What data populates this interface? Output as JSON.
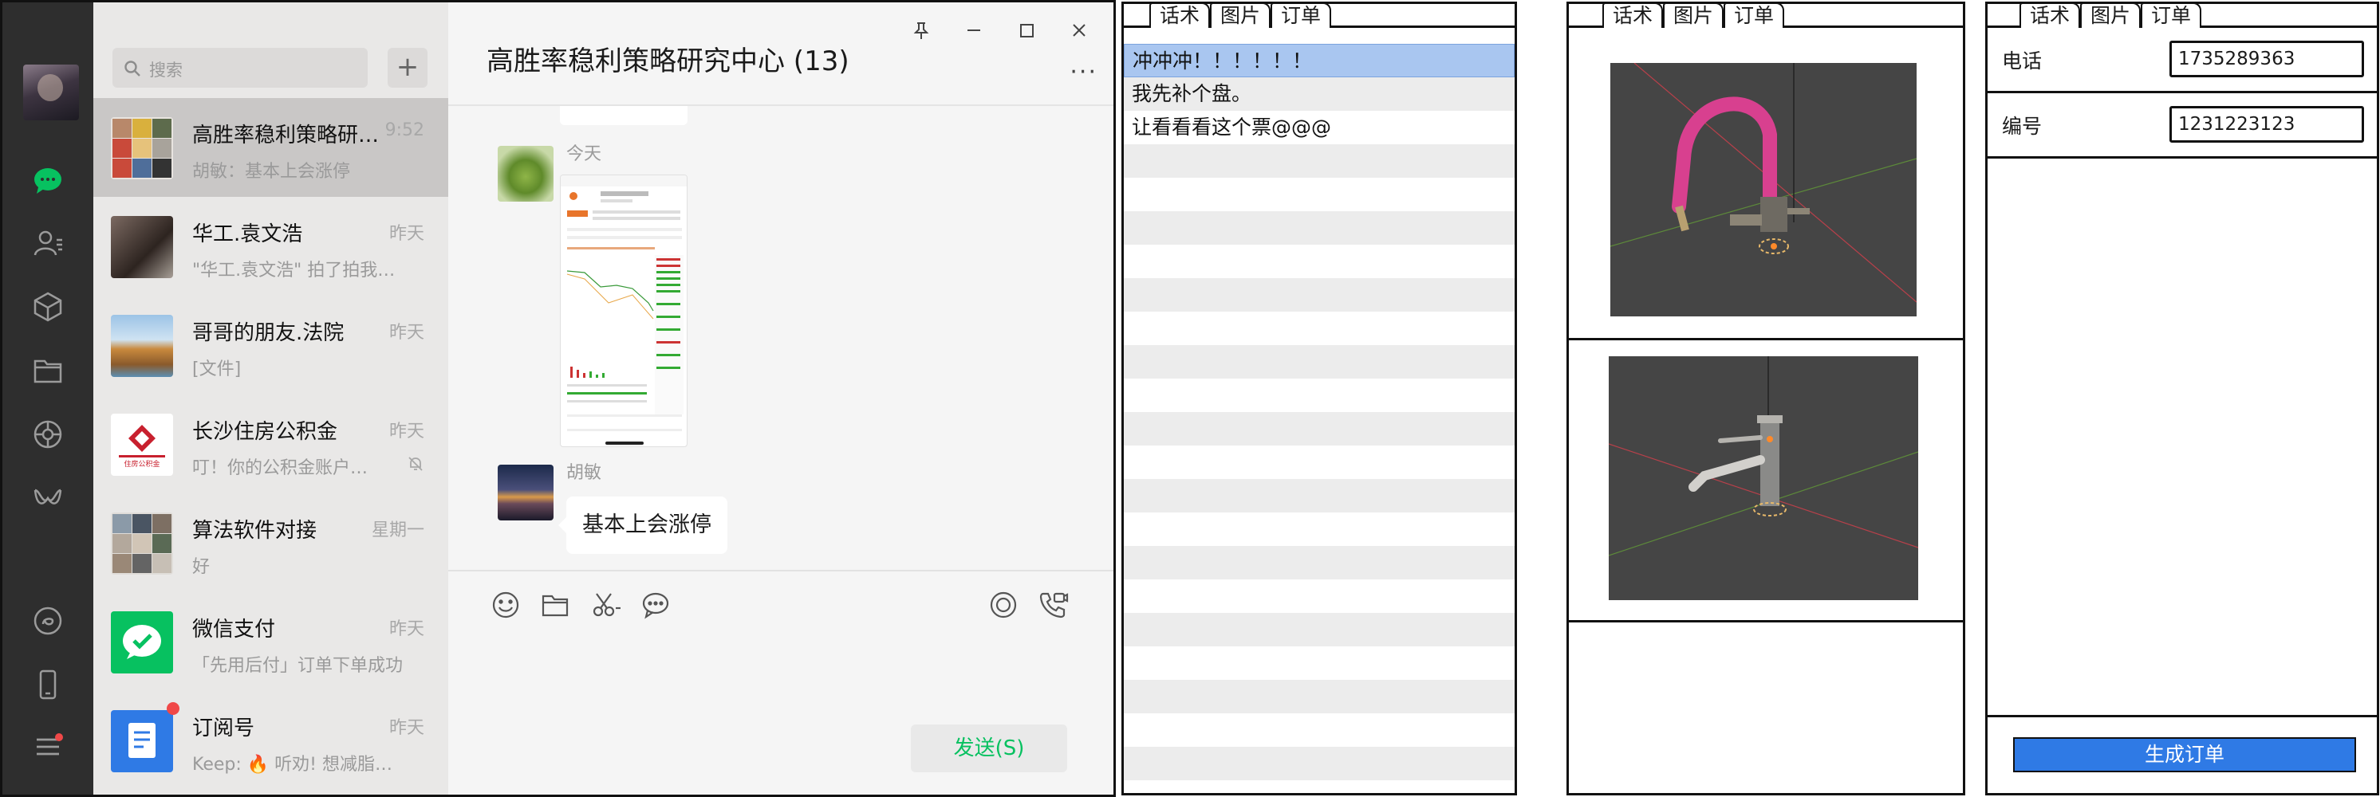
{
  "wechat": {
    "search_placeholder": "搜索",
    "add_label": "+",
    "group_title": "高胜率稳利策略研究中心 (13)",
    "more_label": "···",
    "date_divider": "今天",
    "sender_name": "胡敏",
    "message_text": "基本上会涨停",
    "send_label": "发送(S)",
    "conversations": [
      {
        "name": "高胜率稳利策略研究中心",
        "time": "9:52",
        "preview": "胡敏：基本上会涨停"
      },
      {
        "name": "华工.袁文浩",
        "time": "昨天",
        "preview": "\"华工.袁文浩\" 拍了拍我的肩膀"
      },
      {
        "name": "哥哥的朋友.法院",
        "time": "昨天",
        "preview": "[文件]"
      },
      {
        "name": "长沙住房公积金",
        "time": "昨天",
        "preview": "叮！你的公积金账户有变动"
      },
      {
        "name": "算法软件对接",
        "time": "星期一",
        "preview": "好"
      },
      {
        "name": "微信支付",
        "time": "昨天",
        "preview": "「先用后付」订单下单成功"
      },
      {
        "name": "订阅号",
        "time": "昨天",
        "preview": "Keep: 🔥 听劝! 想减脂先..."
      }
    ],
    "gjj_logo_text": "住房公积金"
  },
  "panel1": {
    "tabs": [
      "话术",
      "图片",
      "订单"
    ],
    "rows": [
      "冲冲冲！！！！！！",
      "我先补个盘。",
      "让看看看这个票@@@"
    ]
  },
  "panel2": {
    "tabs": [
      "话术",
      "图片",
      "订单"
    ]
  },
  "panel3": {
    "tabs": [
      "话术",
      "图片",
      "订单"
    ],
    "phone_label": "电话",
    "phone_value": "1735289363",
    "id_label": "编号",
    "id_value": "1231223123",
    "order_button": "生成订单"
  },
  "colors": {
    "wechat_green": "#07c160",
    "nav_dark": "#2e2e2e",
    "selected_row_blue": "#a9c6f0",
    "order_button_blue": "#2f7ae5",
    "faucet_pink": "#d8408f"
  }
}
